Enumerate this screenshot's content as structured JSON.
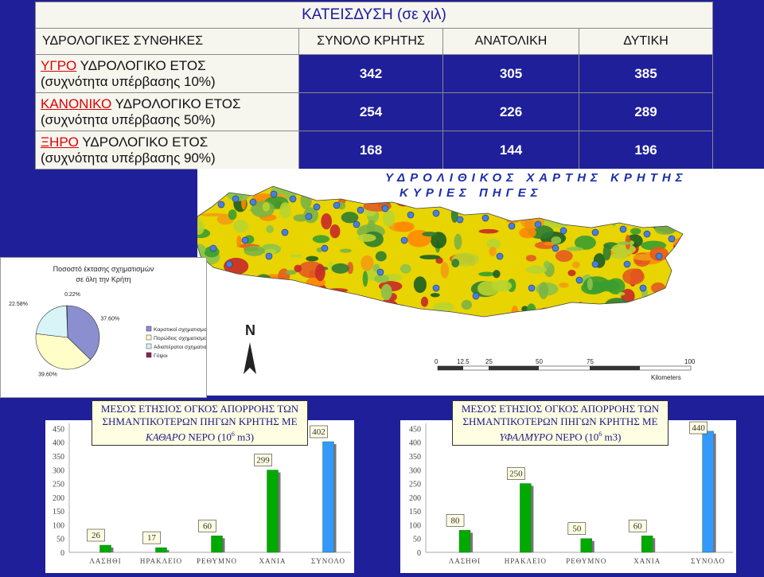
{
  "table": {
    "title": "ΚΑΤΕΙΣΔΥΣΗ (σε χιλ)",
    "headers": [
      "ΥΔΡΟΛΟΓΙΚΕΣ ΣΥΝΘΗΚΕΣ",
      "ΣΥΝΟΛΟ ΚΡΗΤΗΣ",
      "ΑΝΑΤΟΛΙΚΗ",
      "ΔΥΤΙΚΗ"
    ],
    "rows": [
      {
        "keyword": "ΥΓΡΟ",
        "rest": " ΥΔΡΟΛΟΓΙΚΟ ΕΤΟΣ",
        "line2": "(συχνότητα υπέρβασης 10%)",
        "total": "342",
        "east": "305",
        "west": "385"
      },
      {
        "keyword": "ΚΑΝΟΝΙΚΟ",
        "rest": " ΥΔΡΟΛΟΓΙΚΟ ΕΤΟΣ",
        "line2": " (συχνότητα υπέρβασης 50%)",
        "total": "254",
        "east": "226",
        "west": "289"
      },
      {
        "keyword": "ΞΗΡΟ",
        "rest": " ΥΔΡΟΛΟΓΙΚΟ ΕΤΟΣ",
        "line2": "(συχνότητα υπέρβασης 90%)",
        "total": "168",
        "east": "144",
        "west": "196"
      }
    ]
  },
  "map": {
    "title_line1": "ΥΔΡΟΛΙΘΙΚΟΣ ΧΑΡΤΗΣ ΚΡΗΤΗΣ",
    "title_line2": "ΚΥΡΙΕΣ ΠΗΓΕΣ",
    "north": "N",
    "scale_ticks": [
      "0",
      "12.5",
      "25",
      "50",
      "75",
      "100"
    ],
    "scale_unit": "Kilometers"
  },
  "pie": {
    "title_line1": "Ποσοστό έκτασης σχηματισμών",
    "title_line2": "σε όλη την Κρήτη"
  },
  "chart_data": [
    {
      "type": "pie",
      "title": "Ποσοστό έκτασης σχηματισμών σε όλη την Κρήτη",
      "categories": [
        "Καρστικοί σχηματισμοί",
        "Πορώδεις σχηματισμοί",
        "Αδιαπέρατοι σχηματισμοί",
        "Γύψοι"
      ],
      "values": [
        37.6,
        39.6,
        22.58,
        0.22
      ],
      "labels": [
        "37.60%",
        "39.60%",
        "22.58%",
        "0.22%"
      ],
      "colors": [
        "#8b8fd0",
        "#fffec8",
        "#d8f4f7",
        "#8b2252"
      ],
      "legend": "right"
    },
    {
      "type": "bar",
      "title": "ΜΕΣΟΣ ΕΤΗΣΙΟΣ ΟΓΚΟΣ ΑΠΟΡΡΟΗΣ ΤΩΝ ΣΗΜΑΝΤΙΚΟΤΕΡΩΝ ΠΗΓΩΝ ΚΡΗΤΗΣ ΜΕ ΚΑΘΑΡΟ ΝΕΡΟ (10⁶ m3)",
      "title_line1": "ΜΕΣΟΣ ΕΤΗΣΙΟΣ ΟΓΚΟΣ ΑΠΟΡΡΟΗΣ ΤΩΝ",
      "title_line2": "ΣΗΜΑΝΤΙΚΟΤΕΡΩΝ ΠΗΓΩΝ ΚΡΗΤΗΣ ΜΕ",
      "title_italic": "ΚΑΘΑΡΟ",
      "title_line3": "ΝΕΡΟ (10",
      "title_sup": "6",
      "title_end": " m3)",
      "categories": [
        "ΛΑΣΗΘΙ",
        "ΗΡΑΚΛΕΙΟ",
        "ΡΕΘΥΜΝΟ",
        "ΧΑΝΙΑ",
        "ΣΥΝΟΛΟ"
      ],
      "values": [
        26,
        17,
        60,
        299,
        402
      ],
      "yticks": [
        0,
        50,
        100,
        150,
        200,
        250,
        300,
        350,
        400,
        450
      ],
      "ylim": [
        0,
        480
      ],
      "colors": [
        "#00aa00",
        "#00aa00",
        "#00aa00",
        "#00aa00",
        "#3399ff"
      ]
    },
    {
      "type": "bar",
      "title": "ΜΕΣΟΣ ΕΤΗΣΙΟΣ ΟΓΚΟΣ ΑΠΟΡΡΟΗΣ ΤΩΝ ΣΗΜΑΝΤΙΚΟΤΕΡΩΝ ΠΗΓΩΝ ΚΡΗΤΗΣ ΜΕ ΥΦΑΛΜΥΡΟ ΝΕΡΟ (10⁶ m3)",
      "title_line1": "ΜΕΣΟΣ ΕΤΗΣΙΟΣ ΟΓΚΟΣ ΑΠΟΡΡΟΗΣ ΤΩΝ",
      "title_line2": "ΣΗΜΑΝΤΙΚΟΤΕΡΩΝ ΠΗΓΩΝ ΚΡΗΤΗΣ ΜΕ",
      "title_italic": "ΥΦΑΛΜΥΡΟ",
      "title_line3": "ΝΕΡΟ (10",
      "title_sup": "6",
      "title_end": " m3)",
      "categories": [
        "ΛΑΣΗΘΙ",
        "ΗΡΑΚΛΕΙΟ",
        "ΡΕΘΥΜΝΟ",
        "ΧΑΝΙΑ",
        "ΣΥΝΟΛΟ"
      ],
      "values": [
        80,
        250,
        50,
        60,
        440
      ],
      "yticks": [
        0,
        50,
        100,
        150,
        200,
        250,
        300,
        350,
        400,
        450
      ],
      "ylim": [
        0,
        480
      ],
      "colors": [
        "#00aa00",
        "#00aa00",
        "#00aa00",
        "#00aa00",
        "#3399ff"
      ]
    }
  ]
}
